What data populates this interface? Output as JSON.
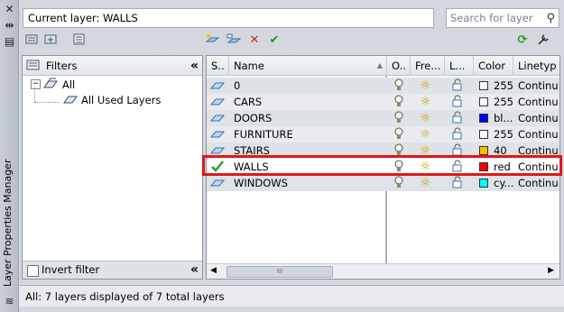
{
  "window": {
    "vertical_title": "Layer Properties Manager",
    "current_layer": "Current layer: WALLS",
    "search_placeholder": "Search for layer"
  },
  "filters": {
    "header": "Filters",
    "tree": [
      {
        "label": "All"
      },
      {
        "label": "All Used Layers"
      }
    ],
    "invert_filter_label": "Invert filter"
  },
  "grid": {
    "columns": [
      "S..",
      "Name",
      "O..",
      "Fre...",
      "L...",
      "Color",
      "Linetyp"
    ],
    "rows": [
      {
        "name": "0",
        "color_name": "255",
        "color_hex": "#ffffff",
        "linetype": "Continu",
        "current": false
      },
      {
        "name": "CARS",
        "color_name": "255",
        "color_hex": "#ffffff",
        "linetype": "Continu",
        "current": false
      },
      {
        "name": "DOORS",
        "color_name": "bl...",
        "color_hex": "#0000ff",
        "linetype": "Continu",
        "current": false
      },
      {
        "name": "FURNITURE",
        "color_name": "255",
        "color_hex": "#ffffff",
        "linetype": "Continu",
        "current": false
      },
      {
        "name": "STAIRS",
        "color_name": "40",
        "color_hex": "#ffbf00",
        "linetype": "Continu",
        "current": false
      },
      {
        "name": "WALLS",
        "color_name": "red",
        "color_hex": "#ff0000",
        "linetype": "Continu",
        "current": true
      },
      {
        "name": "WINDOWS",
        "color_name": "cy...",
        "color_hex": "#00ffff",
        "linetype": "Continu",
        "current": false
      }
    ],
    "scroll_thumb_glyph": "III"
  },
  "status": "All: 7 layers displayed of 7 total layers",
  "accent_highlight": "#e01818"
}
